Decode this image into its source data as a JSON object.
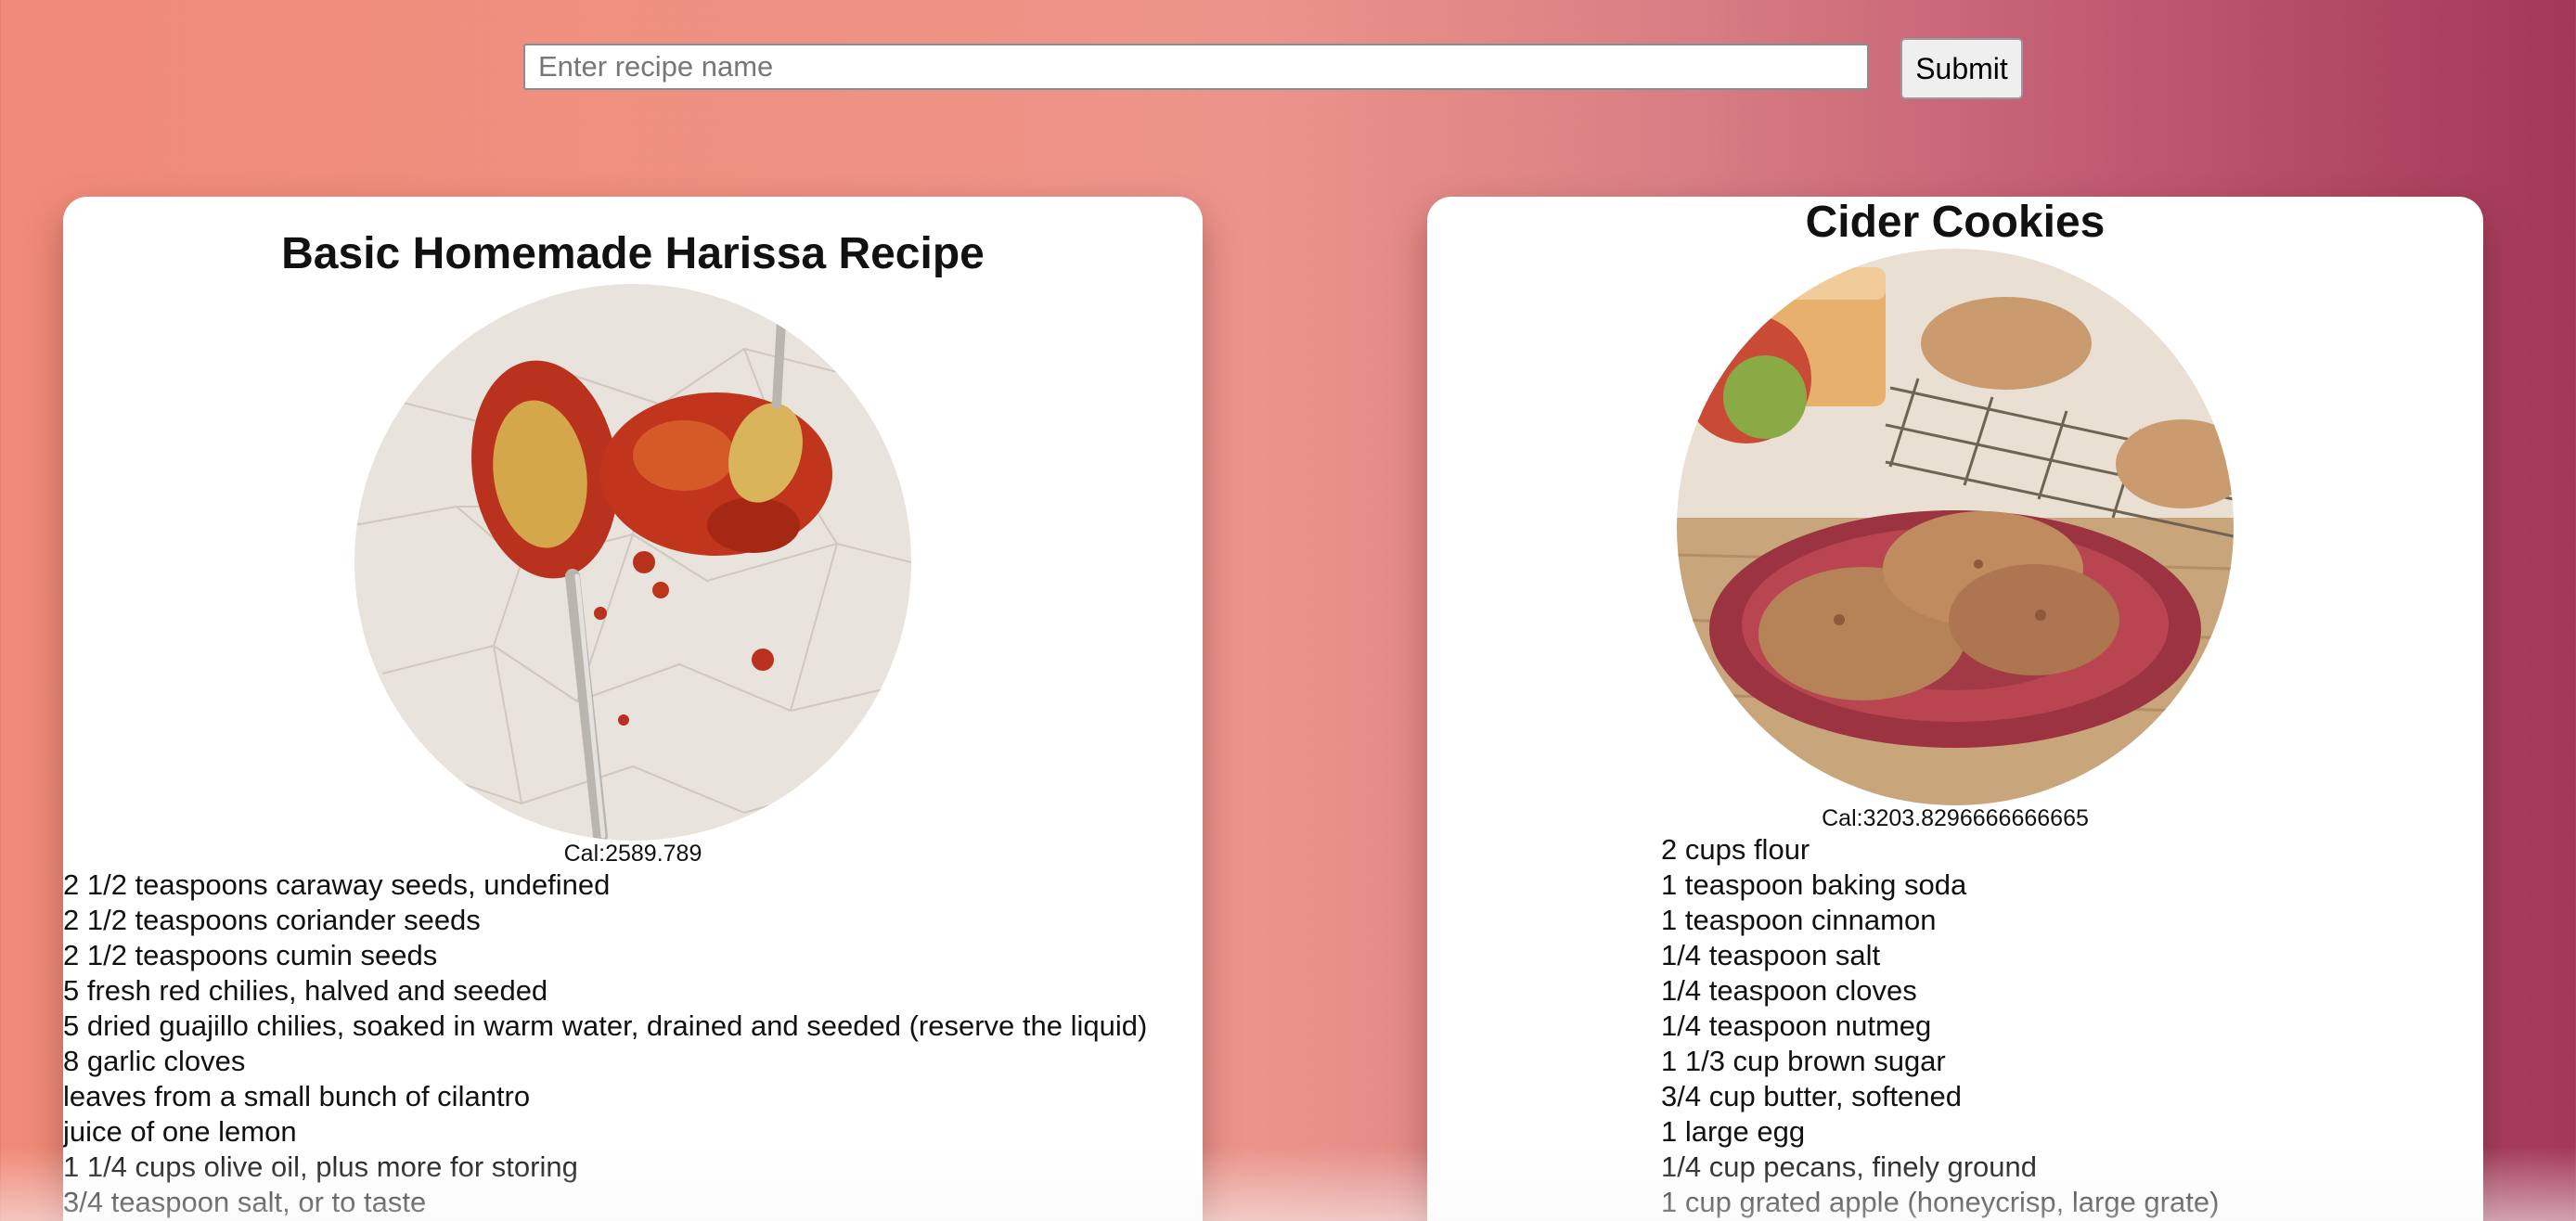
{
  "search": {
    "placeholder": "Enter recipe name",
    "value": "",
    "submit_label": "Submit"
  },
  "recipes": [
    {
      "title": "Basic Homemade Harissa Recipe",
      "calories": "Cal:2589.789",
      "ingredients": [
        "2 1/2 teaspoons caraway seeds, undefined",
        "2 1/2 teaspoons coriander seeds",
        "2 1/2 teaspoons cumin seeds",
        "5 fresh red chilies, halved and seeded",
        "5 dried guajillo chilies, soaked in warm water, drained and seeded (reserve the liquid)",
        "8 garlic cloves",
        "leaves from a small bunch of cilantro",
        "juice of one lemon",
        "1 1/4 cups olive oil, plus more for storing",
        "3/4 teaspoon salt, or to taste"
      ]
    },
    {
      "title": "Cider Cookies",
      "calories": "Cal:3203.8296666666665",
      "ingredients": [
        "2 cups flour",
        "1 teaspoon baking soda",
        "1 teaspoon cinnamon",
        "1/4 teaspoon salt",
        "1/4 teaspoon cloves",
        "1/4 teaspoon nutmeg",
        "1 1/3 cup brown sugar",
        "3/4 cup butter, softened",
        "1 large egg",
        "1/4 cup pecans, finely ground",
        "1 cup grated apple (honeycrisp, large grate)"
      ]
    }
  ]
}
